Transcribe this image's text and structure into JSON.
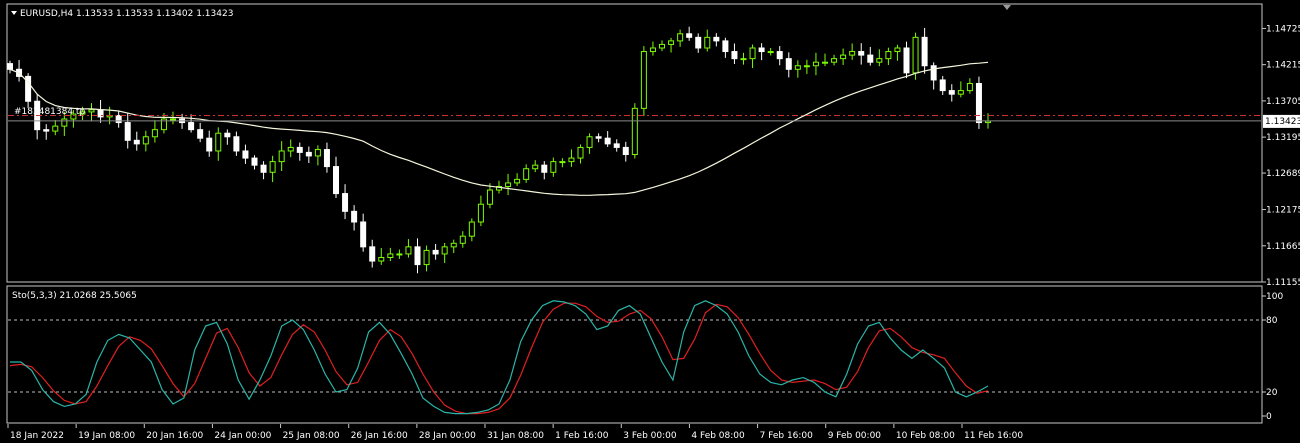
{
  "main_chart": {
    "header": "EURUSD,H4  1.13533 1.13533 1.13402 1.13423",
    "current_price": "1.13423",
    "order_label": "#183481384 tp",
    "colors": {
      "bull": "#7CFC00",
      "bear": "#FFFFFF",
      "ma": "#F5F5DC",
      "tp": "#CC3333"
    }
  },
  "indicator": {
    "header": "Sto(5,3,3) 21.0268 25.5065",
    "levels": [
      "100",
      "80",
      "20",
      "0"
    ],
    "colors": {
      "main": "#2AB5A8",
      "signal": "#E02020"
    }
  },
  "time_labels": [
    "18 Jan 2022",
    "19 Jan 08:00",
    "20 Jan 16:00",
    "24 Jan 00:00",
    "25 Jan 08:00",
    "26 Jan 16:00",
    "28 Jan 00:00",
    "31 Jan 08:00",
    "1 Feb 16:00",
    "3 Feb 00:00",
    "4 Feb 08:00",
    "7 Feb 16:00",
    "9 Feb 00:00",
    "10 Feb 08:00",
    "11 Feb 16:00"
  ],
  "chart_data": [
    {
      "type": "candlestick",
      "title": "EURUSD,H4",
      "ylim": [
        1.11155,
        1.14985
      ],
      "y_ticks": [
        "1.14725",
        "1.14215",
        "1.13705",
        "1.13195",
        "1.12689",
        "1.12175",
        "1.11665",
        "1.11155"
      ],
      "x_ticks": [
        "18 Jan 2022",
        "19 Jan 08:00",
        "20 Jan 16:00",
        "24 Jan 00:00",
        "25 Jan 08:00",
        "26 Jan 16:00",
        "28 Jan 00:00",
        "31 Jan 08:00",
        "1 Feb 16:00",
        "3 Feb 00:00",
        "4 Feb 08:00",
        "7 Feb 16:00",
        "9 Feb 00:00",
        "10 Feb 08:00",
        "11 Feb 16:00"
      ],
      "last_price": 1.13423,
      "take_profit": 1.135,
      "close": [
        1.1415,
        1.1405,
        1.137,
        1.133,
        1.1328,
        1.1335,
        1.1345,
        1.1352,
        1.1355,
        1.1358,
        1.1348,
        1.135,
        1.134,
        1.1315,
        1.131,
        1.132,
        1.133,
        1.1345,
        1.1345,
        1.134,
        1.133,
        1.1318,
        1.13,
        1.1325,
        1.132,
        1.13,
        1.129,
        1.128,
        1.127,
        1.1285,
        1.13,
        1.1305,
        1.1298,
        1.1293,
        1.1302,
        1.1278,
        1.124,
        1.1215,
        1.12,
        1.1165,
        1.1145,
        1.115,
        1.1155,
        1.1155,
        1.1165,
        1.114,
        1.116,
        1.1155,
        1.1165,
        1.117,
        1.118,
        1.12,
        1.1225,
        1.1245,
        1.125,
        1.1255,
        1.126,
        1.1275,
        1.128,
        1.127,
        1.1285,
        1.1285,
        1.129,
        1.1305,
        1.132,
        1.1318,
        1.131,
        1.1305,
        1.1295,
        1.136,
        1.144,
        1.1445,
        1.145,
        1.1455,
        1.1465,
        1.146,
        1.1445,
        1.146,
        1.1455,
        1.144,
        1.143,
        1.143,
        1.1445,
        1.144,
        1.144,
        1.143,
        1.1415,
        1.142,
        1.142,
        1.1425,
        1.1425,
        1.143,
        1.1435,
        1.144,
        1.1435,
        1.1425,
        1.143,
        1.144,
        1.1445,
        1.141,
        1.146,
        1.142,
        1.14,
        1.1385,
        1.138,
        1.1385,
        1.1395,
        1.134,
        1.1342
      ],
      "series": []
    },
    {
      "type": "line",
      "title": "Sto(5,3,3) 21.0268 25.5065",
      "ylim": [
        0,
        100
      ],
      "levels": [
        80,
        20
      ],
      "series": [
        {
          "name": "",
          "values": [
            45,
            45,
            38,
            22,
            12,
            8,
            10,
            18,
            45,
            63,
            68,
            65,
            55,
            45,
            22,
            10,
            15,
            55,
            75,
            78,
            60,
            30,
            14,
            30,
            50,
            75,
            80,
            72,
            55,
            35,
            20,
            22,
            40,
            70,
            78,
            68,
            52,
            35,
            15,
            8,
            3,
            2,
            2,
            3,
            5,
            10,
            30,
            62,
            80,
            92,
            96,
            95,
            92,
            85,
            72,
            75,
            88,
            92,
            85,
            65,
            45,
            30,
            70,
            92,
            96,
            92,
            85,
            70,
            50,
            35,
            28,
            26,
            30,
            32,
            28,
            20,
            16,
            35,
            60,
            75,
            78,
            65,
            55,
            48,
            55,
            48,
            40,
            20,
            16,
            20,
            25
          ]
        },
        {
          "name": "",
          "values": [
            42,
            43,
            41,
            32,
            21,
            13,
            10,
            12,
            25,
            42,
            58,
            66,
            63,
            56,
            42,
            27,
            16,
            27,
            48,
            69,
            73,
            57,
            36,
            25,
            32,
            51,
            68,
            76,
            70,
            55,
            37,
            26,
            28,
            45,
            63,
            72,
            66,
            52,
            35,
            20,
            9,
            4,
            2,
            2,
            3,
            6,
            15,
            34,
            57,
            78,
            89,
            94,
            94,
            91,
            83,
            78,
            79,
            85,
            88,
            81,
            66,
            47,
            48,
            64,
            86,
            93,
            91,
            82,
            68,
            52,
            38,
            30,
            28,
            29,
            30,
            27,
            22,
            24,
            37,
            57,
            71,
            73,
            66,
            57,
            53,
            51,
            48,
            36,
            25,
            19,
            21
          ]
        }
      ]
    }
  ]
}
